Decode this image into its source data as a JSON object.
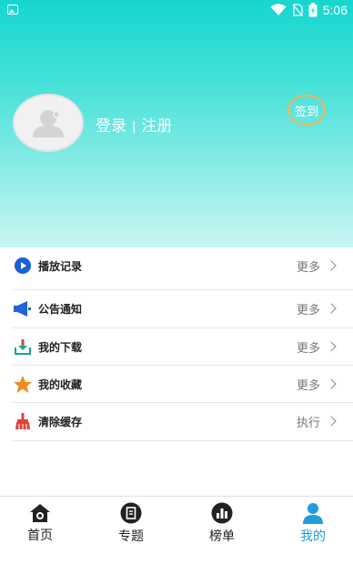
{
  "status_bar": {
    "time": "5:06"
  },
  "profile": {
    "login": "登录",
    "separator": "|",
    "register": "注册",
    "checkin": "签到"
  },
  "menu": [
    {
      "label": "播放记录",
      "action": "更多",
      "icon": "play-icon",
      "color": "#1a5fd6"
    },
    {
      "label": "公告通知",
      "action": "更多",
      "icon": "megaphone-icon",
      "color": "#1f64d8"
    },
    {
      "label": "我的下载",
      "action": "更多",
      "icon": "download-icon",
      "color": "#1aa58a"
    },
    {
      "label": "我的收藏",
      "action": "更多",
      "icon": "star-icon",
      "color": "#f08a1c"
    },
    {
      "label": "清除缓存",
      "action": "执行",
      "icon": "broom-icon",
      "color": "#e0453a"
    }
  ],
  "tabs": [
    {
      "label": "首页",
      "icon": "home-icon"
    },
    {
      "label": "专题",
      "icon": "book-icon"
    },
    {
      "label": "榜单",
      "icon": "chart-icon"
    },
    {
      "label": "我的",
      "icon": "person-icon",
      "active": true
    }
  ],
  "colors": {
    "header_top": "#16d6cf",
    "accent": "#1f9ddc",
    "checkin_ring": "#f3b657"
  }
}
